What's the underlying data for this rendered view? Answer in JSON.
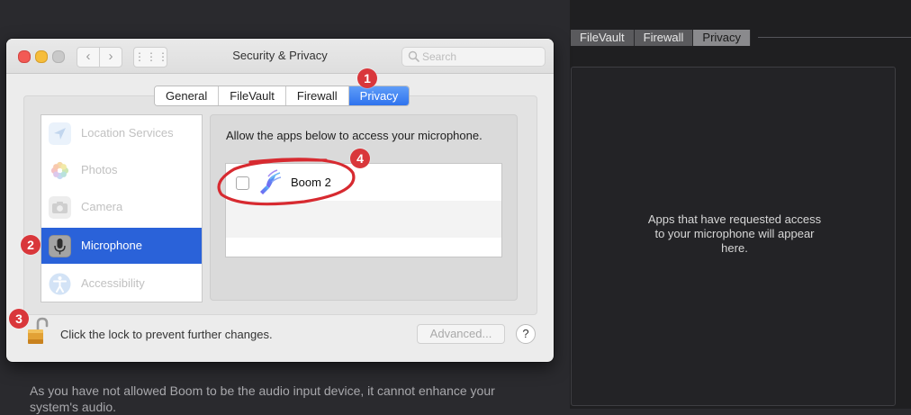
{
  "background": {
    "tabs": [
      {
        "label": "FileVault",
        "selected": false
      },
      {
        "label": "Firewall",
        "selected": false
      },
      {
        "label": "Privacy",
        "selected": true
      }
    ],
    "empty_message_line1": "Apps that have requested access",
    "empty_message_line2": "to your microphone will appear",
    "empty_message_line3": "here.",
    "note_line1": "As you have not allowed Boom to be the audio input device, it cannot enhance your",
    "note_line2": "system's audio."
  },
  "window": {
    "title": "Security & Privacy",
    "back_glyph": "‹",
    "forward_glyph": "›",
    "grid_glyph": "⋮⋮⋮",
    "search_placeholder": "Search"
  },
  "tabs": [
    {
      "label": "General",
      "selected": false
    },
    {
      "label": "FileVault",
      "selected": false
    },
    {
      "label": "Firewall",
      "selected": false
    },
    {
      "label": "Privacy",
      "selected": true
    }
  ],
  "privacy_list": [
    {
      "label": "Location Services",
      "icon": "location-arrow-icon",
      "selected": false
    },
    {
      "label": "Photos",
      "icon": "photos-flower-icon",
      "selected": false
    },
    {
      "label": "Camera",
      "icon": "camera-icon",
      "selected": false
    },
    {
      "label": "Microphone",
      "icon": "microphone-icon",
      "selected": true
    },
    {
      "label": "Accessibility",
      "icon": "accessibility-icon",
      "selected": false
    }
  ],
  "microphone": {
    "prompt": "Allow the apps below to access your microphone.",
    "apps": [
      {
        "name": "Boom 2",
        "checked": false,
        "icon": "boom-app-icon"
      }
    ]
  },
  "footer": {
    "lock_text": "Click the lock to prevent further changes.",
    "advanced_label": "Advanced...",
    "help_label": "?"
  },
  "annotations": [
    "1",
    "2",
    "3",
    "4"
  ],
  "colors": {
    "selection_blue": "#2a62d9",
    "tab_blue": "#3b7df0",
    "annotation_red": "#d9373b"
  }
}
